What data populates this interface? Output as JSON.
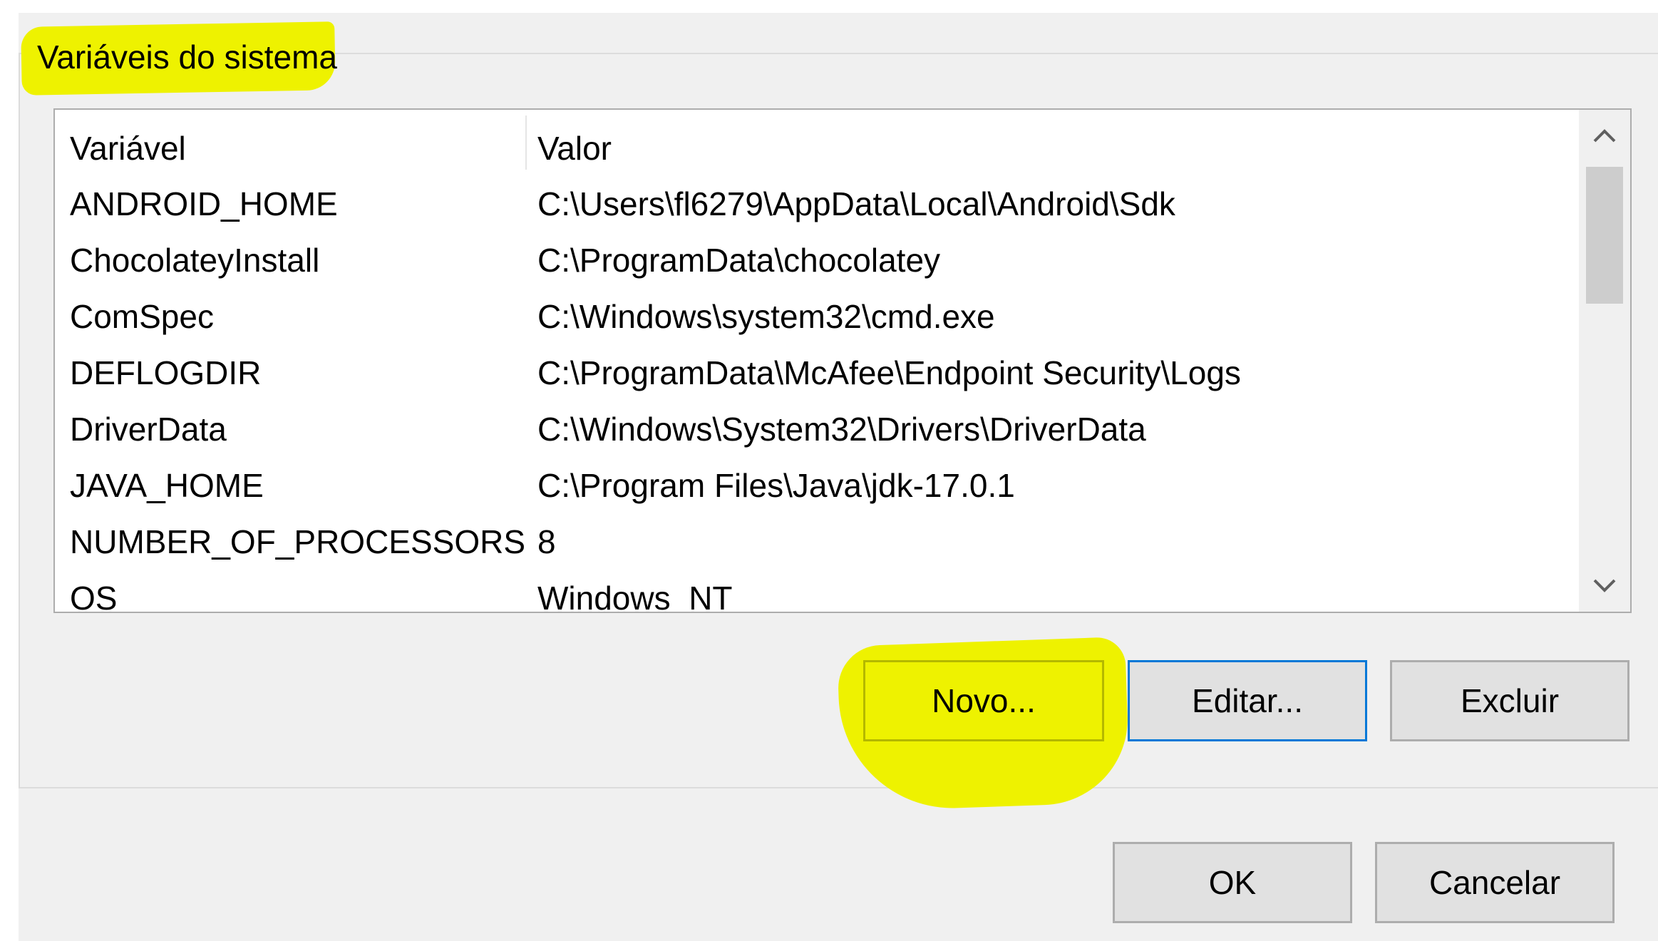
{
  "group": {
    "title": "Variáveis do sistema"
  },
  "list": {
    "columns": [
      "Variável",
      "Valor"
    ],
    "rows": [
      {
        "name": "ANDROID_HOME",
        "value": "C:\\Users\\fl6279\\AppData\\Local\\Android\\Sdk"
      },
      {
        "name": "ChocolateyInstall",
        "value": "C:\\ProgramData\\chocolatey"
      },
      {
        "name": "ComSpec",
        "value": "C:\\Windows\\system32\\cmd.exe"
      },
      {
        "name": "DEFLOGDIR",
        "value": "C:\\ProgramData\\McAfee\\Endpoint Security\\Logs"
      },
      {
        "name": "DriverData",
        "value": "C:\\Windows\\System32\\Drivers\\DriverData"
      },
      {
        "name": "JAVA_HOME",
        "value": "C:\\Program Files\\Java\\jdk-17.0.1"
      },
      {
        "name": "NUMBER_OF_PROCESSORS",
        "value": "8"
      },
      {
        "name": "OS",
        "value": "Windows_NT"
      }
    ]
  },
  "buttons": {
    "new_label": "Novo...",
    "edit_label": "Editar...",
    "delete_label": "Excluir",
    "ok_label": "OK",
    "cancel_label": "Cancelar"
  },
  "icons": {
    "scroll_up": "chevron-up-icon",
    "scroll_down": "chevron-down-icon"
  },
  "colors": {
    "highlight": "#eef200",
    "focus_border": "#0078d7"
  }
}
